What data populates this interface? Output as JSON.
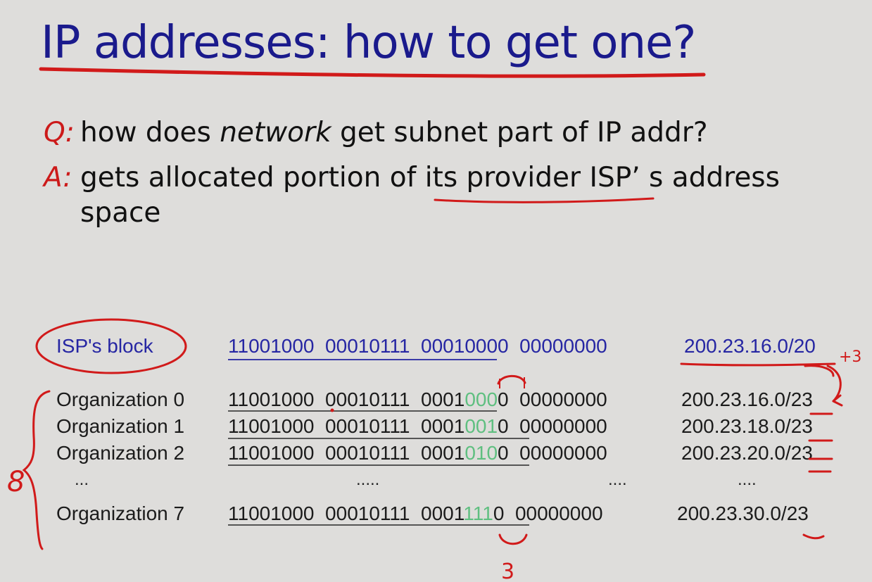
{
  "title": "IP addresses: how to get one?",
  "question": {
    "prefix": "Q:",
    "text_before": "how does ",
    "text_em": "network",
    "text_after": " get subnet part of IP addr?"
  },
  "answer": {
    "prefix": "A:",
    "line1": "gets allocated portion of its provider ISP’ s address",
    "line2": "space"
  },
  "table": {
    "isp": {
      "label": "ISP's block",
      "binary": "11001000  00010111  00010000  00000000",
      "dotted": "200.23.16.0/20"
    },
    "rows": [
      {
        "label": "Organization 0",
        "bin_a": "11001000  00010111  0001",
        "bin_g": "000",
        "bin_b": "0  00000000",
        "dotted": "200.23.16.0/23"
      },
      {
        "label": "Organization 1",
        "bin_a": "11001000  00010111  0001",
        "bin_g": "001",
        "bin_b": "0  00000000",
        "dotted": "200.23.18.0/23"
      },
      {
        "label": "Organization 2",
        "bin_a": "11001000  00010111  0001",
        "bin_g": "010",
        "bin_b": "0  00000000",
        "dotted": "200.23.20.0/23"
      },
      {
        "label": "Organization 7",
        "bin_a": "11001000  00010111  0001",
        "bin_g": "111",
        "bin_b": "0  00000000",
        "dotted": "200.23.30.0/23"
      }
    ],
    "ellipsis_label": "...",
    "ellipsis_binary": ".....",
    "ellipsis_binary2": "....",
    "ellipsis_dotted": "...."
  },
  "annotations": {
    "plus3": "+3",
    "bits3": "3",
    "eight": "8"
  },
  "colors": {
    "title": "#1a1a8c",
    "accent_red": "#cc1a1a",
    "isp_blue": "#2626a3",
    "green_bits": "#5fbf80",
    "background": "#dedddb"
  }
}
